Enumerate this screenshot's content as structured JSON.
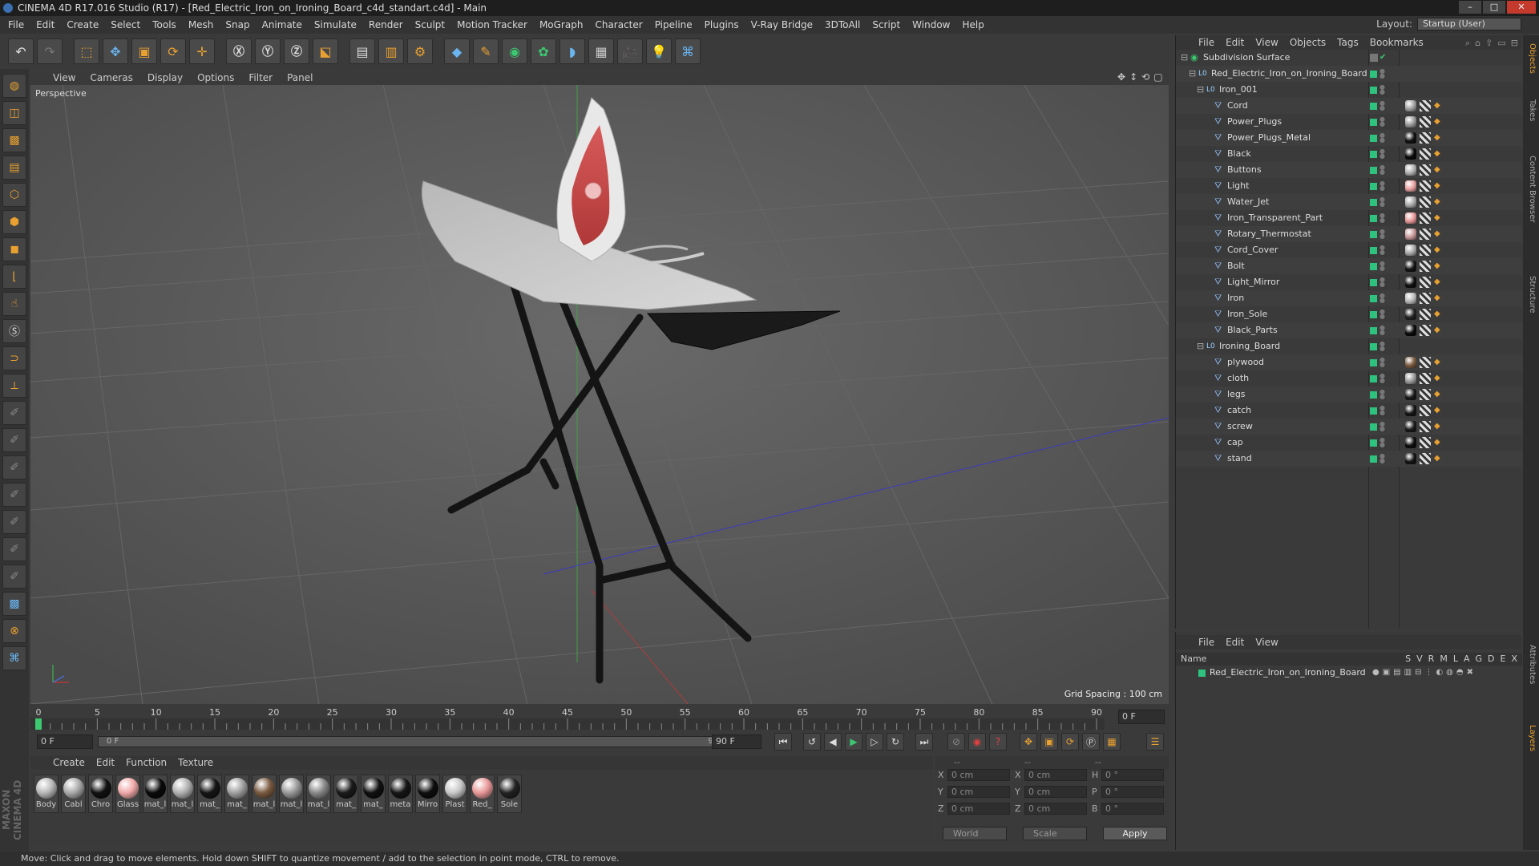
{
  "window": {
    "title": "CINEMA 4D R17.016 Studio (R17) - [Red_Electric_Iron_on_Ironing_Board_c4d_standart.c4d] - Main"
  },
  "menu": [
    "File",
    "Edit",
    "Create",
    "Select",
    "Tools",
    "Mesh",
    "Snap",
    "Animate",
    "Simulate",
    "Render",
    "Sculpt",
    "Motion Tracker",
    "MoGraph",
    "Character",
    "Pipeline",
    "Plugins",
    "V-Ray Bridge",
    "3DToAll",
    "Script",
    "Window",
    "Help"
  ],
  "layout": {
    "label": "Layout:",
    "value": "Startup (User)"
  },
  "viewport": {
    "menu": [
      "View",
      "Cameras",
      "Display",
      "Options",
      "Filter",
      "Panel"
    ],
    "label": "Perspective",
    "grid_spacing": "Grid Spacing : 100 cm"
  },
  "timeline": {
    "ticks": [
      "0",
      "5",
      "10",
      "15",
      "20",
      "25",
      "30",
      "35",
      "40",
      "45",
      "50",
      "55",
      "60",
      "65",
      "70",
      "75",
      "80",
      "85",
      "90"
    ],
    "current_frame": "0 F",
    "start_field": "0 F",
    "range_start": "0 F",
    "range_end": "90 F",
    "end_field": "90 F"
  },
  "material_panel": {
    "menu": [
      "Create",
      "Edit",
      "Function",
      "Texture"
    ],
    "materials": [
      {
        "label": "Body",
        "color": "#b8b8b8"
      },
      {
        "label": "Cabl",
        "color": "#a8a8a8"
      },
      {
        "label": "Chro",
        "color": "#111111"
      },
      {
        "label": "Glass",
        "color": "#f0a8a8"
      },
      {
        "label": "mat_l",
        "color": "#0a0a0a"
      },
      {
        "label": "mat_l",
        "color": "#b0b0b0"
      },
      {
        "label": "mat_",
        "color": "#151515"
      },
      {
        "label": "mat_",
        "color": "#a0a0a0"
      },
      {
        "label": "mat_l",
        "color": "#7a5a40"
      },
      {
        "label": "mat_l",
        "color": "#999999"
      },
      {
        "label": "mat_l",
        "color": "#888888"
      },
      {
        "label": "mat_",
        "color": "#1a1a1a"
      },
      {
        "label": "mat_",
        "color": "#101010"
      },
      {
        "label": "meta",
        "color": "#151515"
      },
      {
        "label": "Mirro",
        "color": "#0e0e0e"
      },
      {
        "label": "Plast",
        "color": "#c8c8c8"
      },
      {
        "label": "Red_",
        "color": "#e89898"
      },
      {
        "label": "Sole",
        "color": "#222222"
      }
    ]
  },
  "coordinates": {
    "header": [
      "--",
      "--",
      "--"
    ],
    "rows": [
      {
        "a": "X",
        "av": "0 cm",
        "b": "X",
        "bv": "0 cm",
        "c": "H",
        "cv": "0 °"
      },
      {
        "a": "Y",
        "av": "0 cm",
        "b": "Y",
        "bv": "0 cm",
        "c": "P",
        "cv": "0 °"
      },
      {
        "a": "Z",
        "av": "0 cm",
        "b": "Z",
        "bv": "0 cm",
        "c": "B",
        "cv": "0 °"
      }
    ],
    "space": "World",
    "mode": "Scale",
    "apply": "Apply"
  },
  "object_manager": {
    "menu": [
      "File",
      "Edit",
      "View",
      "Objects",
      "Tags",
      "Bookmarks"
    ],
    "objects": [
      {
        "name": "Subdivision Surface",
        "level": 0,
        "type": "subdiv",
        "tag": ""
      },
      {
        "name": "Red_Electric_Iron_on_Ironing_Board",
        "level": 1,
        "type": "null",
        "tag": ""
      },
      {
        "name": "Iron_001",
        "level": 2,
        "type": "null",
        "tag": ""
      },
      {
        "name": "Cord",
        "level": 3,
        "type": "poly",
        "tag": "#a0a0a0"
      },
      {
        "name": "Power_Plugs",
        "level": 3,
        "type": "poly",
        "tag": "#999999"
      },
      {
        "name": "Power_Plugs_Metal",
        "level": 3,
        "type": "poly",
        "tag": "#111111"
      },
      {
        "name": "Black",
        "level": 3,
        "type": "poly",
        "tag": "#0a0a0a"
      },
      {
        "name": "Buttons",
        "level": 3,
        "type": "poly",
        "tag": "#b0b0b0"
      },
      {
        "name": "Light",
        "level": 3,
        "type": "poly",
        "tag": "#e8a0a0"
      },
      {
        "name": "Water_Jet",
        "level": 3,
        "type": "poly",
        "tag": "#aaaaaa"
      },
      {
        "name": "Iron_Transparent_Part",
        "level": 3,
        "type": "poly",
        "tag": "#e89898"
      },
      {
        "name": "Rotary_Thermostat",
        "level": 3,
        "type": "poly",
        "tag": "#c89898"
      },
      {
        "name": "Cord_Cover",
        "level": 3,
        "type": "poly",
        "tag": "#a8a8a8"
      },
      {
        "name": "Bolt",
        "level": 3,
        "type": "poly",
        "tag": "#151515"
      },
      {
        "name": "Light_Mirror",
        "level": 3,
        "type": "poly",
        "tag": "#101010"
      },
      {
        "name": "Iron",
        "level": 3,
        "type": "poly",
        "tag": "#b8b8b8"
      },
      {
        "name": "Iron_Sole",
        "level": 3,
        "type": "poly",
        "tag": "#222222"
      },
      {
        "name": "Black_Parts",
        "level": 3,
        "type": "poly",
        "tag": "#0a0a0a"
      },
      {
        "name": "Ironing_Board",
        "level": 2,
        "type": "null",
        "tag": ""
      },
      {
        "name": "plywood",
        "level": 3,
        "type": "poly",
        "tag": "#7a5a40"
      },
      {
        "name": "cloth",
        "level": 3,
        "type": "poly",
        "tag": "#999999"
      },
      {
        "name": "legs",
        "level": 3,
        "type": "poly",
        "tag": "#1a1a1a"
      },
      {
        "name": "catch",
        "level": 3,
        "type": "poly",
        "tag": "#151515"
      },
      {
        "name": "screw",
        "level": 3,
        "type": "poly",
        "tag": "#1a1a1a"
      },
      {
        "name": "cap",
        "level": 3,
        "type": "poly",
        "tag": "#0e0e0e"
      },
      {
        "name": "stand",
        "level": 3,
        "type": "poly",
        "tag": "#151515"
      }
    ]
  },
  "layer_manager": {
    "menu": [
      "File",
      "Edit",
      "View"
    ],
    "name_header": "Name",
    "columns": [
      "S",
      "V",
      "R",
      "M",
      "L",
      "A",
      "G",
      "D",
      "E",
      "X"
    ],
    "layers": [
      {
        "name": "Red_Electric_Iron_on_Ironing_Board",
        "color": "#2ec27e"
      }
    ]
  },
  "side_tabs": [
    "Objects",
    "Takes",
    "Content Browser",
    "Structure",
    "Attributes",
    "Layers"
  ],
  "status": "Move: Click and drag to move elements. Hold down SHIFT to quantize movement / add to the selection in point mode, CTRL to remove."
}
